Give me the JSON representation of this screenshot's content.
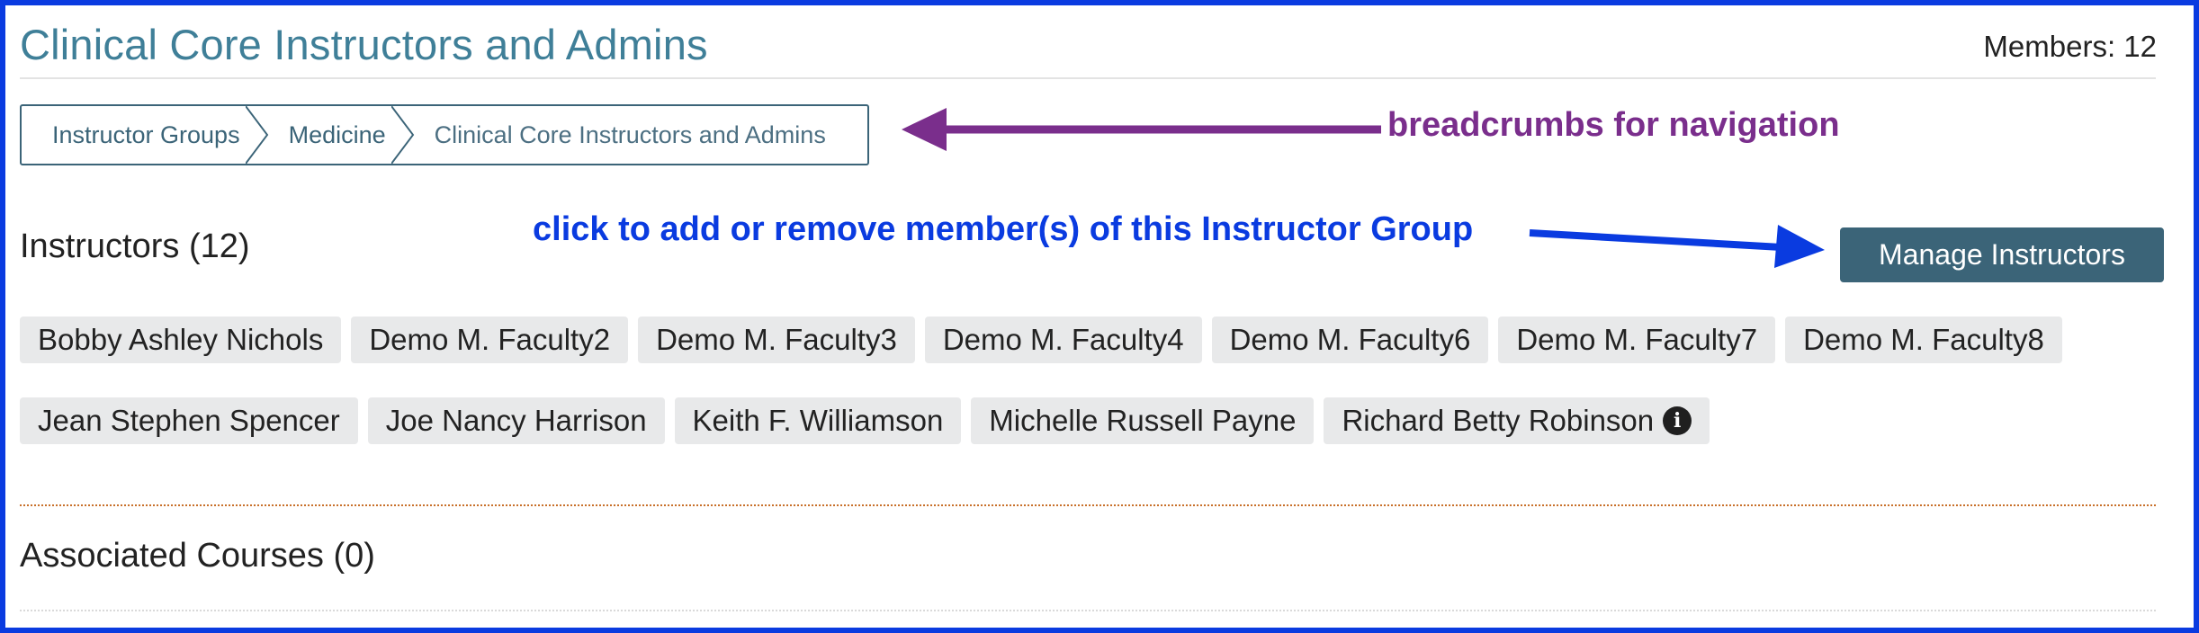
{
  "header": {
    "title": "Clinical Core Instructors and Admins",
    "members_label": "Members: 12"
  },
  "breadcrumbs": [
    {
      "label": "Instructor Groups"
    },
    {
      "label": "Medicine"
    },
    {
      "label": "Clinical Core Instructors and Admins"
    }
  ],
  "annotations": {
    "breadcrumbs_note": "breadcrumbs for navigation",
    "manage_note": "click to add or remove member(s) of this Instructor Group",
    "colors": {
      "purple": "#7a2e8c",
      "blue": "#0a3be0"
    }
  },
  "instructors": {
    "title": "Instructors (12)",
    "manage_button": "Manage Instructors",
    "members_row1": [
      "Bobby Ashley Nichols",
      "Demo M. Faculty2",
      "Demo M. Faculty3",
      "Demo M. Faculty4",
      "Demo M. Faculty6",
      "Demo M. Faculty7",
      "Demo M. Faculty8"
    ],
    "members_row2": [
      "Jean Stephen Spencer",
      "Joe Nancy Harrison",
      "Keith F. Williamson",
      "Michelle Russell Payne",
      "Richard Betty Robinson"
    ],
    "info_icon": "info-circle-icon"
  },
  "courses": {
    "title": "Associated Courses (0)"
  },
  "theme": {
    "accent": "#3b6478",
    "title_color": "#3f7f98",
    "frame_color": "#0a3be0"
  }
}
